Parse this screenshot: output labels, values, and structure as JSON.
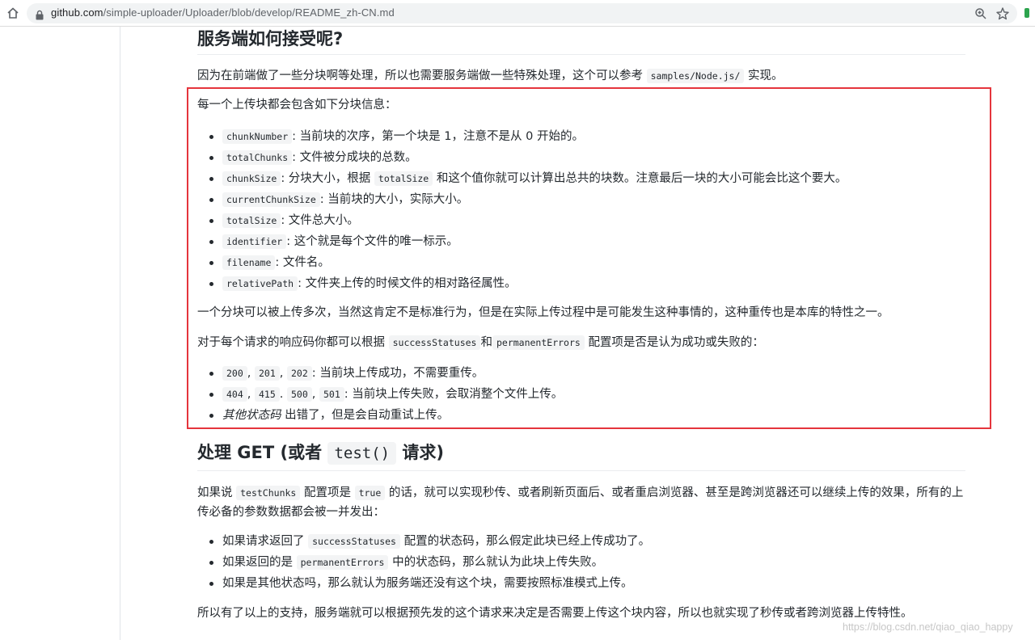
{
  "browser": {
    "url_host": "github.com",
    "url_path": "/simple-uploader/Uploader/blob/develop/README_zh-CN.md"
  },
  "section1": {
    "heading": "服务端如何接受呢?",
    "intro_before": "因为在前端做了一些分块啊等处理，所以也需要服务端做一些特殊处理，这个可以参考",
    "intro_code": "samples/Node.js/",
    "intro_after": "实现。",
    "chunk_intro": "每一个上传块都会包含如下分块信息：",
    "chunk_items": [
      {
        "code": "chunkNumber",
        "text": ": 当前块的次序，第一个块是 1，注意不是从 0 开始的。"
      },
      {
        "code": "totalChunks",
        "text": ": 文件被分成块的总数。"
      },
      {
        "code": "chunkSize",
        "text": ": 分块大小，根据"
      },
      {
        "code": "currentChunkSize",
        "text": ": 当前块的大小，实际大小。"
      },
      {
        "code": "totalSize",
        "text": ": 文件总大小。"
      },
      {
        "code": "identifier",
        "text": ": 这个就是每个文件的唯一标示。"
      },
      {
        "code": "filename",
        "text": ": 文件名。"
      },
      {
        "code": "relativePath",
        "text": ": 文件夹上传的时候文件的相对路径属性。"
      }
    ],
    "chunksize_code2": "totalSize",
    "chunksize_after": "和这个值你就可以计算出总共的块数。注意最后一块的大小可能会比这个要大。",
    "multi_upload": "一个分块可以被上传多次，当然这肯定不是标准行为，但是在实际上传过程中是可能发生这种事情的，这种重传也是本库的特性之一。",
    "status_before": "对于每个请求的响应码你都可以根据",
    "status_code1": "successStatuses",
    "status_and": "和",
    "status_code2": "permanentErrors",
    "status_after": "配置项是否是认为成功或失败的：",
    "success_codes": [
      "200",
      "201",
      "202"
    ],
    "success_text": ": 当前块上传成功，不需要重传。",
    "fail_codes": [
      "404",
      "415",
      "500",
      "501"
    ],
    "fail_text": ": 当前块上传失败，会取消整个文件上传。",
    "other_em": "其他状态码",
    "other_text": "出错了，但是会自动重试上传。",
    "comma": ",",
    "dot": "."
  },
  "section2": {
    "heading_before": "处理 GET (或者",
    "heading_code": "test()",
    "heading_after": "请求)",
    "p_before": "如果说",
    "p_code1": "testChunks",
    "p_mid1": "配置项是",
    "p_code2": "true",
    "p_after": "的话，就可以实现秒传、或者刷新页面后、或者重启浏览器、甚至是跨浏览器还可以继续上传的效果，所有的上传必备的参数数据都会被一并发出：",
    "items": [
      {
        "before": "如果请求返回了",
        "code": "successStatuses",
        "after": "配置的状态码，那么假定此块已经上传成功了。"
      },
      {
        "before": "如果返回的是",
        "code": "permanentErrors",
        "after": "中的状态码，那么就认为此块上传失败。"
      },
      {
        "before": "如果是其他状态吗，那么就认为服务端还没有这个块，需要按照标准模式上传。",
        "code": "",
        "after": ""
      }
    ],
    "conclusion": "所以有了以上的支持，服务端就可以根据预先发的这个请求来决定是否需要上传这个块内容，所以也就实现了秒传或者跨浏览器上传特性。"
  },
  "watermark": "https://blog.csdn.net/qiao_qiao_happy"
}
